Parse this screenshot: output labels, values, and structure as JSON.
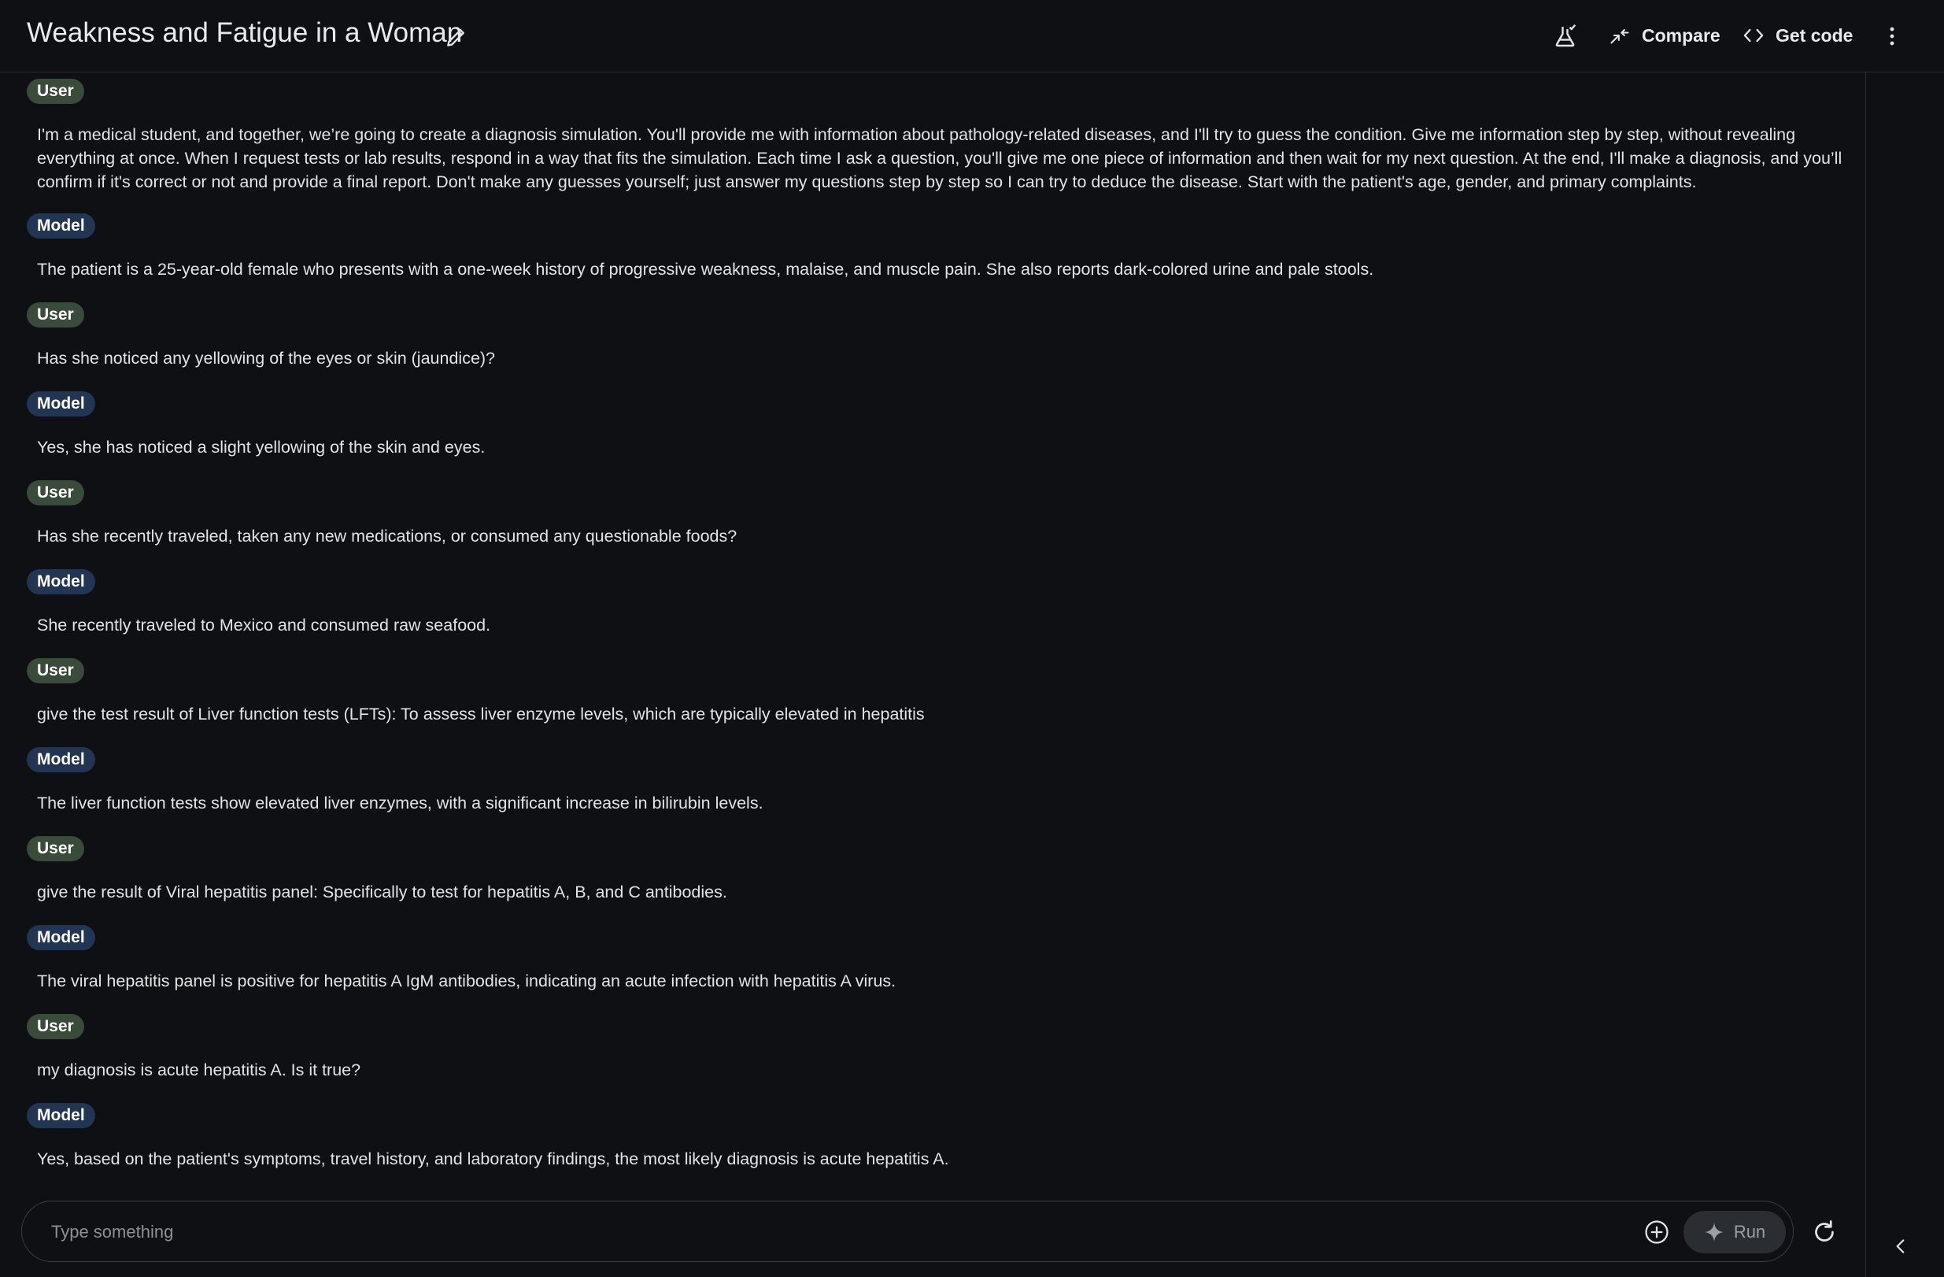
{
  "header": {
    "title": "Weakness and Fatigue in a Woman",
    "compare_label": "Compare",
    "get_code_label": "Get code"
  },
  "chat": {
    "turns": [
      {
        "role": "User",
        "text": "I'm a medical student, and together, we’re going to create a diagnosis simulation. You'll provide me with information about pathology-related diseases, and I'll try to guess the condition. Give me information step by step, without revealing everything at once. When I request tests or lab results, respond in a way that fits the simulation. Each time I ask a question, you'll give me one piece of information and then wait for my next question. At the end, I'll make a diagnosis, and you’ll confirm if it's correct or not and provide a final report. Don't make any guesses yourself; just answer my questions step by step so I can try to deduce the disease. Start with the patient's age, gender, and primary complaints."
      },
      {
        "role": "Model",
        "text": "The patient is a 25-year-old female who presents with a one-week history of progressive weakness, malaise, and muscle pain. She also reports dark-colored urine and pale stools."
      },
      {
        "role": "User",
        "text": "Has she noticed any yellowing of the eyes or skin (jaundice)?"
      },
      {
        "role": "Model",
        "text": "Yes, she has noticed a slight yellowing of the skin and eyes."
      },
      {
        "role": "User",
        "text": "Has she recently traveled, taken any new medications, or consumed any questionable foods?"
      },
      {
        "role": "Model",
        "text": "She recently traveled to Mexico and consumed raw seafood."
      },
      {
        "role": "User",
        "text": "give the test result of Liver function tests (LFTs): To assess liver enzyme levels, which are typically elevated in hepatitis"
      },
      {
        "role": "Model",
        "text": "The liver function tests show elevated liver enzymes, with a significant increase in bilirubin levels."
      },
      {
        "role": "User",
        "text": "give the result of Viral hepatitis panel: Specifically to test for hepatitis A, B, and C antibodies."
      },
      {
        "role": "Model",
        "text": "The viral hepatitis panel is positive for hepatitis A IgM antibodies, indicating an acute infection with hepatitis A virus."
      },
      {
        "role": "User",
        "text": "my diagnosis is acute hepatitis A. Is it true?"
      },
      {
        "role": "Model",
        "text": "Yes, based on the patient's symptoms, travel history, and laboratory findings, the most likely diagnosis is acute hepatitis A."
      }
    ]
  },
  "composer": {
    "placeholder": "Type something",
    "run_label": "Run"
  },
  "icons": {
    "edit": "pencil-icon",
    "token_meter": "flask-check-icon",
    "compare": "compare-arrows-icon",
    "get_code": "code-brackets-icon",
    "more": "more-vert-icon",
    "add": "add-circle-icon",
    "run": "sparkle-icon",
    "refresh": "refresh-icon",
    "collapse": "chevron-left-icon"
  }
}
